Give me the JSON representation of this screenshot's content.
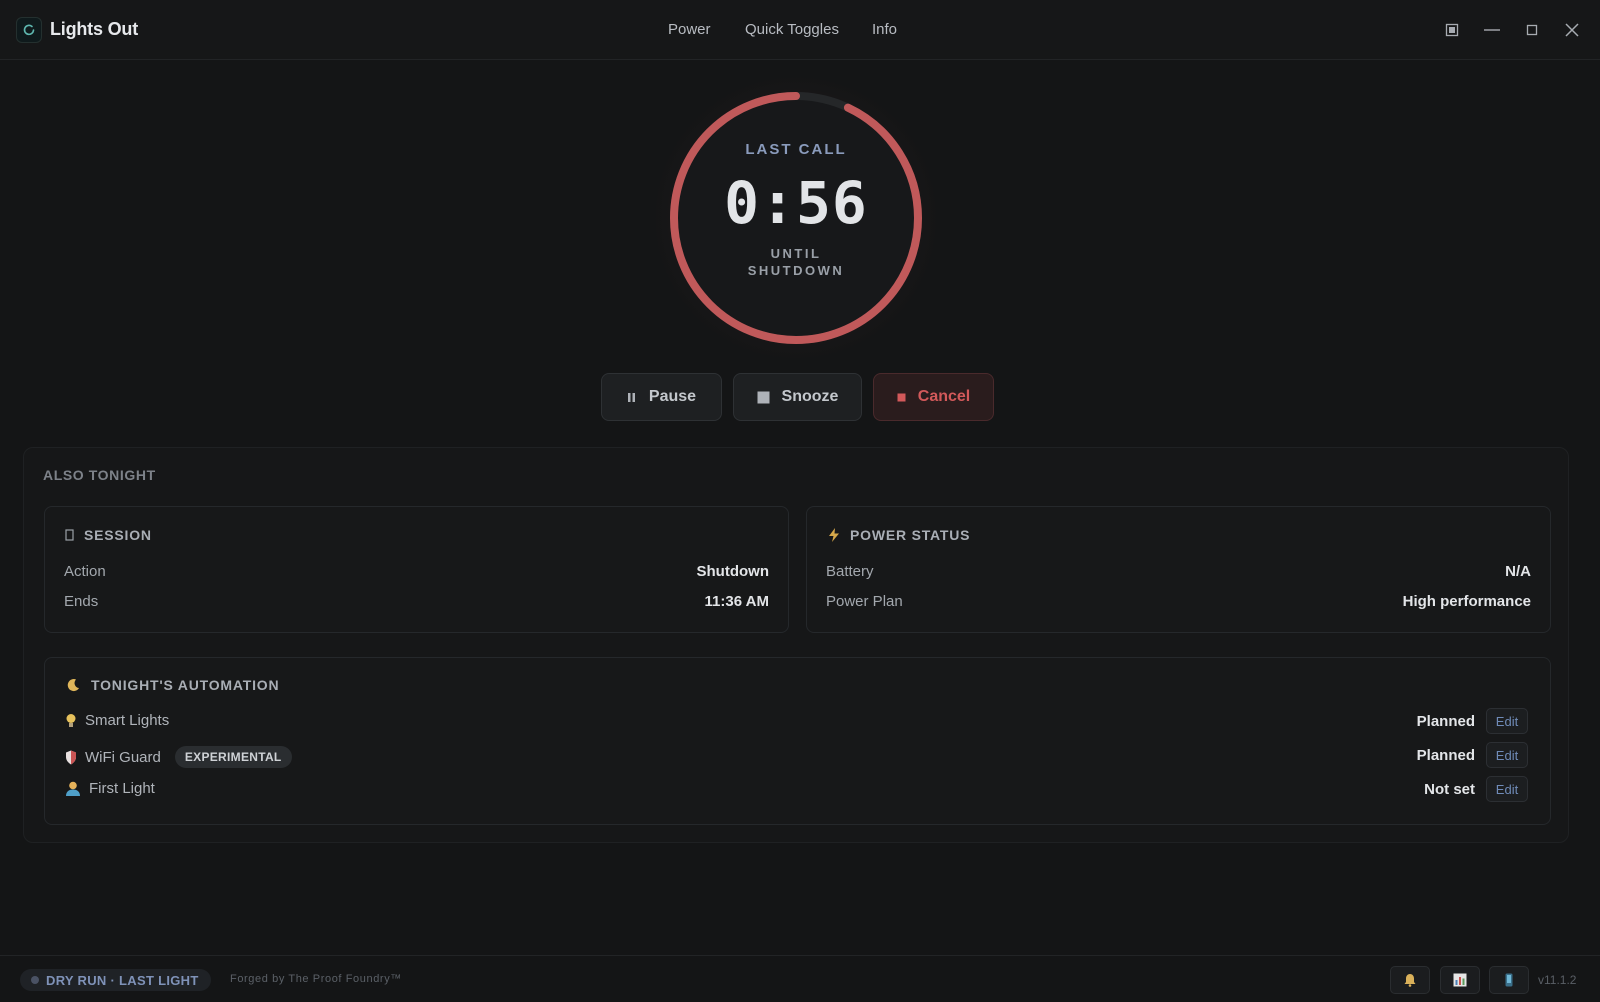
{
  "app": {
    "title": "Lights Out"
  },
  "nav": {
    "items": [
      "Power",
      "Quick Toggles",
      "Info"
    ]
  },
  "timer": {
    "top_label": "LAST CALL",
    "value": "0:56",
    "bottom_label_1": "UNTIL",
    "bottom_label_2": "SHUTDOWN",
    "progress_fraction": 0.93,
    "ring_color": "#c0595a",
    "track_color": "#252729"
  },
  "actions": {
    "pause": "Pause",
    "snooze": "Snooze",
    "cancel": "Cancel"
  },
  "also_tonight": {
    "title": "ALSO TONIGHT",
    "session": {
      "title": "SESSION",
      "rows": [
        {
          "label": "Action",
          "value": "Shutdown"
        },
        {
          "label": "Ends",
          "value": "11:36 AM"
        }
      ]
    },
    "power": {
      "title": "POWER STATUS",
      "rows": [
        {
          "label": "Battery",
          "value": "N/A"
        },
        {
          "label": "Power Plan",
          "value": "High performance"
        }
      ]
    },
    "automation": {
      "title": "TONIGHT'S AUTOMATION",
      "rows": [
        {
          "label": "Smart Lights",
          "status": "Planned",
          "edit": "Edit",
          "icon": "lightbulb-icon"
        },
        {
          "label": "WiFi Guard",
          "badge": "EXPERIMENTAL",
          "status": "Planned",
          "edit": "Edit",
          "icon": "shield-icon"
        },
        {
          "label": "First Light",
          "status": "Not set",
          "edit": "Edit",
          "icon": "person-icon"
        }
      ]
    }
  },
  "footer": {
    "mode": "DRY RUN · LAST LIGHT",
    "credit": "Forged by The Proof Foundry™",
    "version": "v11.1.2"
  },
  "colors": {
    "accent_red": "#c0595a",
    "accent_blue": "#7f92b8",
    "background": "#141516"
  }
}
